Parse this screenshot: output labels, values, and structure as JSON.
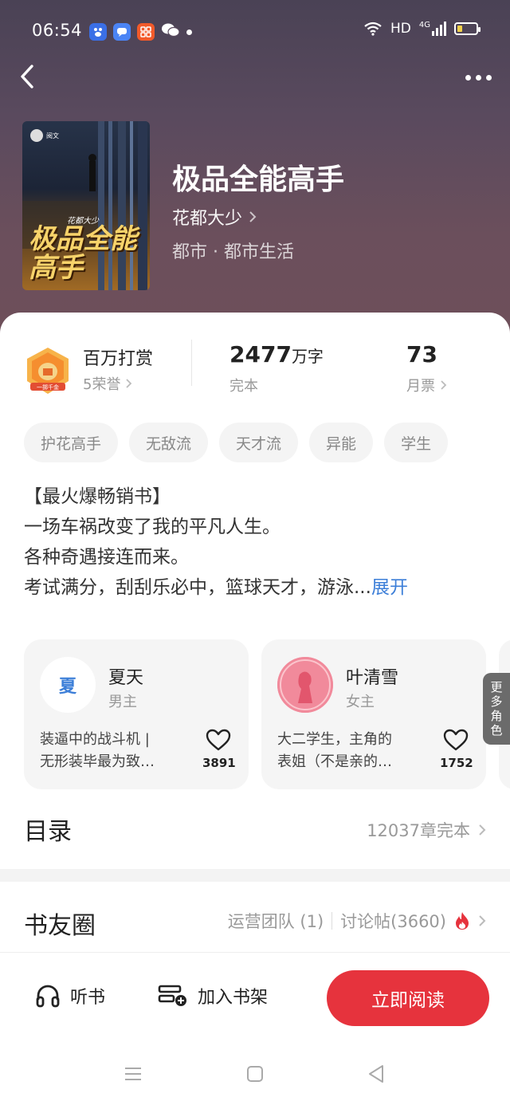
{
  "status_bar": {
    "time": "06:54",
    "network": "HD",
    "signal": "4G",
    "apps": [
      "baidu-icon",
      "chat-bubble-icon",
      "app-grid-icon",
      "wechat-icon"
    ]
  },
  "header": {
    "back_icon": "chevron-left-icon",
    "more_icon": "more-dots-icon"
  },
  "book": {
    "cover_title": "极品全能高手",
    "cover_author": "花都大少",
    "title": "极品全能高手",
    "author": "花都大少",
    "genre": "都市 · 都市生活"
  },
  "stats": {
    "honor_title": "百万打赏",
    "honor_sub": "5荣誉",
    "words": "2477",
    "words_unit": "万字",
    "status": "完本",
    "tickets": "73",
    "tickets_label": "月票"
  },
  "tags": [
    "护花高手",
    "无敌流",
    "天才流",
    "异能",
    "学生"
  ],
  "intro": {
    "lines": [
      "【最火爆畅销书】",
      "一场车祸改变了我的平凡人生。",
      "各种奇遇接连而来。",
      "考试满分，刮刮乐必中，篮球天才，游泳..."
    ],
    "expand": "展开"
  },
  "roles": [
    {
      "avatar_text": "夏",
      "name": "夏天",
      "type": "男主",
      "desc": [
        "装逼中的战斗机 |",
        "无形装毕最为致…"
      ],
      "likes": "3891"
    },
    {
      "avatar_text": "",
      "name": "叶清雪",
      "type": "女主",
      "desc": [
        "大二学生，主角的",
        "表姐（不是亲的…"
      ],
      "likes": "1752"
    }
  ],
  "more_roles": "更多角色",
  "catalog": {
    "title": "目录",
    "info": "12037章完本"
  },
  "circle": {
    "title": "书友圈",
    "team": "运营团队 (1)",
    "posts": "讨论帖(3660)"
  },
  "actions": {
    "listen": "听书",
    "add_shelf": "加入书架",
    "read": "立即阅读"
  },
  "colors": {
    "accent_red": "#e6333d",
    "link_blue": "#3d7fd8"
  }
}
